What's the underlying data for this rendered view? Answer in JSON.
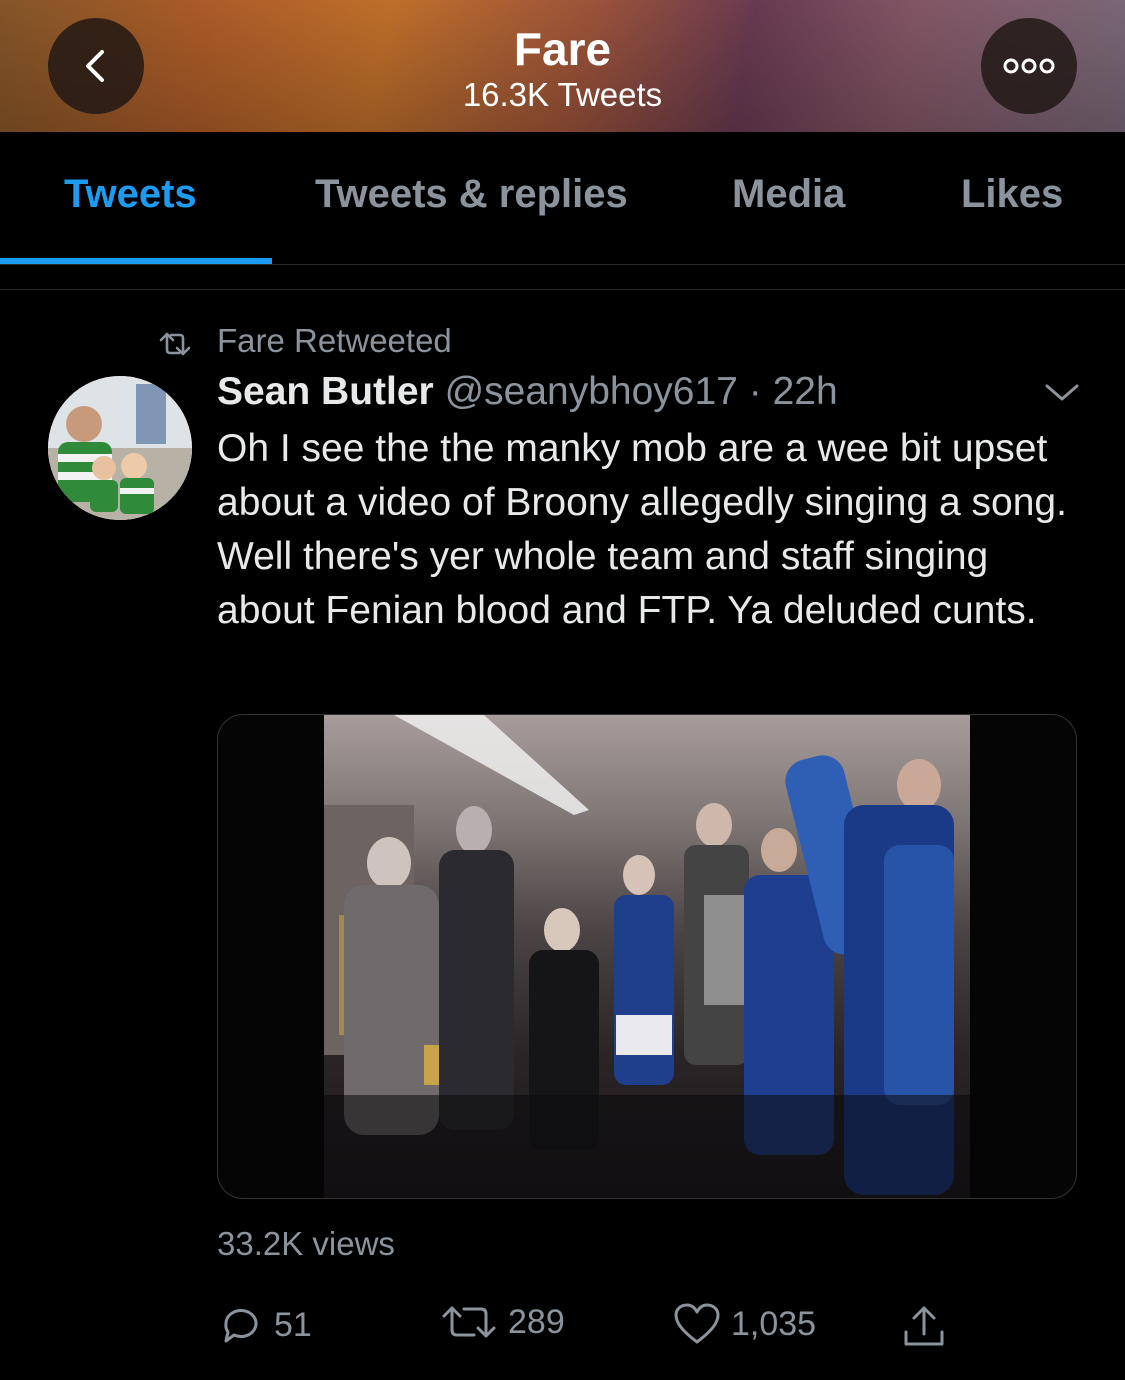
{
  "header": {
    "title": "Fare",
    "subtitle": "16.3K Tweets",
    "back_icon": "chevron-left-icon",
    "more_icon": "more-icon"
  },
  "tabs": [
    {
      "label": "Tweets",
      "active": true
    },
    {
      "label": "Tweets & replies",
      "active": false
    },
    {
      "label": "Media",
      "active": false
    },
    {
      "label": "Likes",
      "active": false
    }
  ],
  "tweet": {
    "retweet_label": "Fare Retweeted",
    "author_name": "Sean Butler",
    "author_handle": "@seanybhoy617",
    "separator": "·",
    "time": "22h",
    "text": "Oh I see the the manky mob are a wee bit upset about a video of Broony allegedly singing a song. Well there's yer whole team and staff singing about Fenian blood and FTP. Ya deluded cunts.",
    "views": "33.2K views",
    "actions": {
      "replies": "51",
      "retweets": "289",
      "likes": "1,035"
    }
  },
  "colors": {
    "accent": "#1d9bf0",
    "background": "#000000",
    "secondary_text": "#8b949c"
  }
}
